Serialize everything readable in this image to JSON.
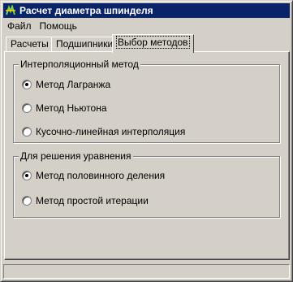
{
  "window": {
    "title": "Расчет диаметра шпинделя"
  },
  "menu": [
    "Файл",
    "Помощь"
  ],
  "tabs": [
    {
      "label": "Расчеты",
      "active": false
    },
    {
      "label": "Подшипники",
      "active": false
    },
    {
      "label": "Выбор методов",
      "active": true
    }
  ],
  "interpolation_group": {
    "title": "Интерполяционный метод",
    "options": [
      {
        "label": "Метод Лагранжа",
        "checked": true
      },
      {
        "label": "Метод Ньютона",
        "checked": false
      },
      {
        "label": "Кусочно-линейная интерполяция",
        "checked": false
      }
    ]
  },
  "equation_group": {
    "title": "Для решения уравнения",
    "options": [
      {
        "label": "Метод половинного деления",
        "checked": true
      },
      {
        "label": "Метод простой итерации",
        "checked": false
      }
    ]
  },
  "colors": {
    "titlebar": "#0a246a",
    "face": "#d4d0c8"
  }
}
